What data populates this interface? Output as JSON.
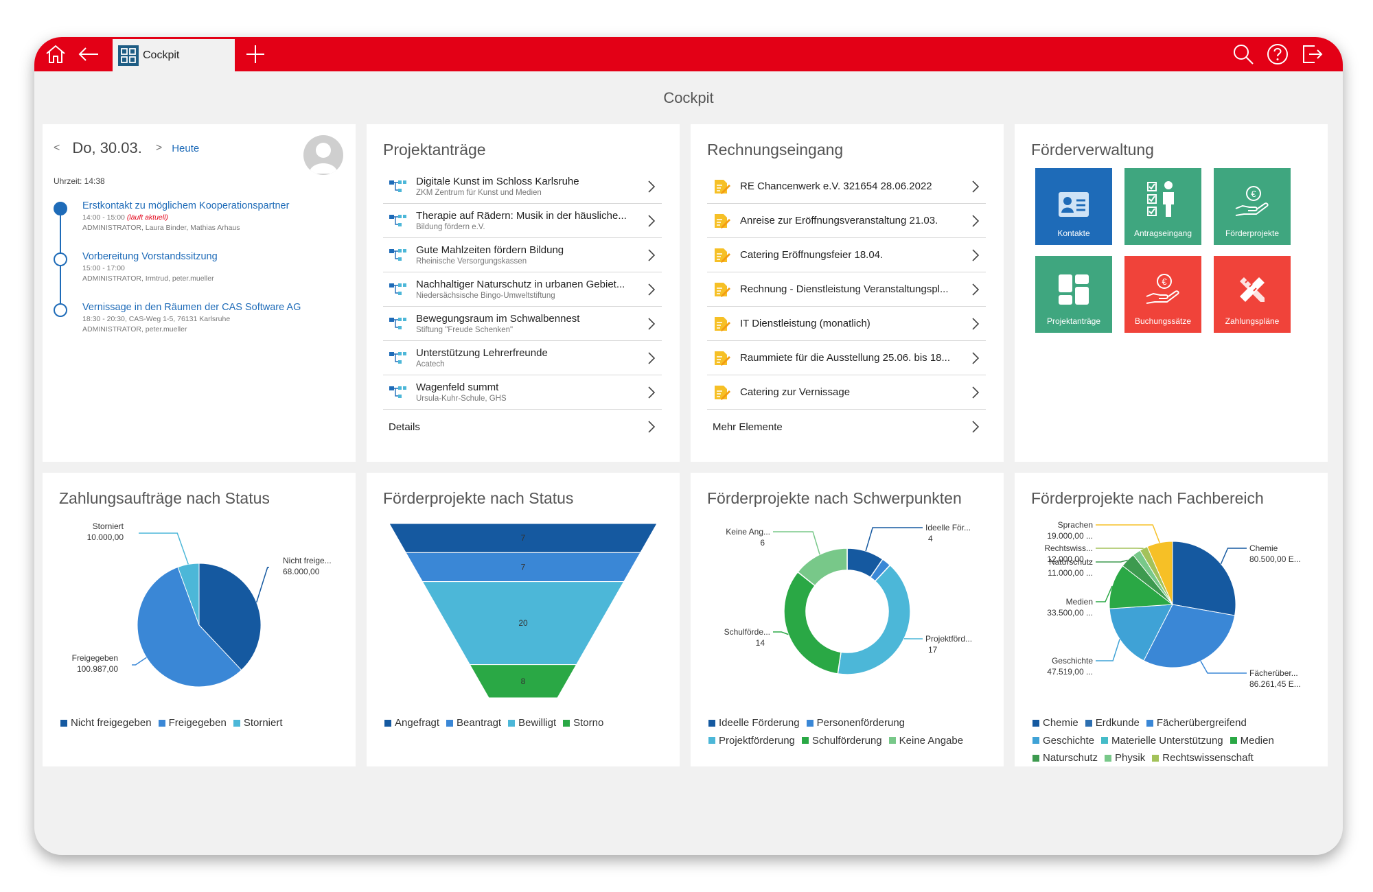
{
  "topbar": {
    "tab_label": "Cockpit",
    "icons": [
      "home-icon",
      "back-arrow-icon",
      "cockpit-logo-icon",
      "plus-icon",
      "search-icon",
      "help-icon",
      "logout-icon"
    ]
  },
  "page": {
    "title": "Cockpit"
  },
  "calendar": {
    "prev": "<",
    "date": "Do, 30.03.",
    "next": ">",
    "today": "Heute",
    "time": "Uhrzeit: 14:38",
    "events": [
      {
        "title": "Erstkontakt zu möglichem Kooperationspartner",
        "time": "14:00 - 15:00",
        "now": "(läuft aktuell)",
        "people": "ADMINISTRATOR,  Laura Binder,  Mathias Arhaus"
      },
      {
        "title": "Vorbereitung Vorstandssitzung",
        "time": "15:00 - 17:00",
        "now": "",
        "people": "ADMINISTRATOR,  Irmtrud,  peter.mueller"
      },
      {
        "title": "Vernissage in den Räumen der CAS Software AG",
        "time": "18:30 - 20:30, CAS-Weg 1-5, 76131 Karlsruhe",
        "now": "",
        "people": "ADMINISTRATOR,  peter.mueller"
      }
    ]
  },
  "projektantraege": {
    "title": "Projektanträge",
    "items": [
      {
        "title": "Digitale Kunst im Schloss Karlsruhe",
        "sub": "ZKM Zentrum für Kunst und Medien"
      },
      {
        "title": "Therapie auf Rädern: Musik in der häusliche...",
        "sub": "Bildung fördern e.V."
      },
      {
        "title": "Gute Mahlzeiten fördern Bildung",
        "sub": "Rheinische Versorgungskassen"
      },
      {
        "title": "Nachhaltiger Naturschutz in urbanen Gebiet...",
        "sub": "Niedersächsische Bingo-Umweltstiftung"
      },
      {
        "title": "Bewegungsraum im Schwalbennest",
        "sub": "Stiftung \"Freude Schenken\""
      },
      {
        "title": "Unterstützung Lehrerfreunde",
        "sub": "Acatech"
      },
      {
        "title": "Wagenfeld summt",
        "sub": "Ursula-Kuhr-Schule, GHS"
      }
    ],
    "footer": "Details"
  },
  "rechnungseingang": {
    "title": "Rechnungseingang",
    "items": [
      "RE Chancenwerk e.V. 321654 28.06.2022",
      "Anreise zur Eröffnungsveranstaltung 21.03.",
      "Catering Eröffnungsfeier 18.04.",
      "Rechnung - Dienstleistung Veranstaltungspl...",
      "IT Dienstleistung (monatlich)",
      "Raummiete für die Ausstellung 25.06. bis 18...",
      "Catering zur Vernissage"
    ],
    "footer": "Mehr Elemente"
  },
  "foerderverwaltung": {
    "title": "Förderverwaltung",
    "tiles": [
      {
        "label": "Kontakte",
        "color": "#1e6bb8",
        "icon": "contact-card-icon"
      },
      {
        "label": "Antragseingang",
        "color": "#3fa67f",
        "icon": "checklist-person-icon"
      },
      {
        "label": "Förderprojekte",
        "color": "#3fa67f",
        "icon": "euro-hand-icon"
      },
      {
        "label": "Projektanträge",
        "color": "#3fa67f",
        "icon": "dashboard-tiles-icon"
      },
      {
        "label": "Buchungssätze",
        "color": "#f0433a",
        "icon": "euro-hand-icon"
      },
      {
        "label": "Zahlungspläne",
        "color": "#f0433a",
        "icon": "pencil-ruler-icon"
      }
    ]
  },
  "chart_titles": {
    "zahlungsauftraege": "Zahlungsaufträge nach Status",
    "foerderprojekte_status": "Förderprojekte nach Status",
    "schwerpunkte": "Förderprojekte nach Schwerpunkten",
    "fachbereich": "Förderprojekte nach Fachbereich"
  },
  "chart_data": [
    {
      "type": "pie",
      "title": "Zahlungsaufträge nach Status",
      "series": [
        {
          "name": "Nicht freigegeben",
          "value": 68000,
          "label": "Nicht freige...",
          "value_label": "68.000,00",
          "color": "#1559a0"
        },
        {
          "name": "Freigegeben",
          "value": 100987,
          "label": "Freigegeben",
          "value_label": "100.987,00",
          "color": "#3a87d6"
        },
        {
          "name": "Storniert",
          "value": 10000,
          "label": "Storniert",
          "value_label": "10.000,00",
          "color": "#4cb7d8"
        }
      ],
      "legend": "bottom"
    },
    {
      "type": "funnel",
      "title": "Förderprojekte nach Status",
      "stages": [
        {
          "name": "Angefragt",
          "value": 7,
          "color": "#1559a0"
        },
        {
          "name": "Beantragt",
          "value": 7,
          "color": "#3a87d6"
        },
        {
          "name": "Bewilligt",
          "value": 20,
          "color": "#4cb7d8"
        },
        {
          "name": "Storno",
          "value": 8,
          "color": "#2aa845"
        }
      ],
      "legend": "bottom"
    },
    {
      "type": "donut",
      "title": "Förderprojekte nach Schwerpunkten",
      "series": [
        {
          "name": "Ideelle Förderung",
          "value": 4,
          "label": "Ideelle För...",
          "color": "#1559a0"
        },
        {
          "name": "Personenförderung",
          "value": 1,
          "label": "",
          "color": "#3a87d6"
        },
        {
          "name": "Projektförderung",
          "value": 17,
          "label": "Projektförd...",
          "color": "#4cb7d8"
        },
        {
          "name": "Schulförderung",
          "value": 14,
          "label": "Schulförde...",
          "color": "#2aa845"
        },
        {
          "name": "Keine Angabe",
          "value": 6,
          "label": "Keine Ang...",
          "color": "#78c889"
        }
      ],
      "legend": "bottom"
    },
    {
      "type": "pie",
      "title": "Förderprojekte nach Fachbereich",
      "series": [
        {
          "name": "Chemie",
          "value": 80500,
          "label": "Chemie",
          "value_label": "80.500,00 E...",
          "color": "#1559a0"
        },
        {
          "name": "Fächerübergreifend",
          "value": 86261.45,
          "label": "Fächerüber...",
          "value_label": "86.261,45 E...",
          "color": "#3a87d6"
        },
        {
          "name": "Geschichte",
          "value": 47519,
          "label": "Geschichte",
          "value_label": "47.519,00 ...",
          "color": "#3fa2d6"
        },
        {
          "name": "Materielle Unterstützung",
          "value": 0,
          "label": "",
          "value_label": "",
          "color": "#45bcc8"
        },
        {
          "name": "Medien",
          "value": 33500,
          "label": "Medien",
          "value_label": "33.500,00 ...",
          "color": "#2aa845"
        },
        {
          "name": "Naturschutz",
          "value": 11000,
          "label": "Naturschutz",
          "value_label": "11.000,00 ...",
          "color": "#3d9a4f"
        },
        {
          "name": "Physik",
          "value": 6000,
          "label": "",
          "value_label": "",
          "color": "#78c889"
        },
        {
          "name": "Rechtswissenschaft",
          "value": 6000,
          "label": "Rechtswiss...",
          "value_label": "12.000,00 ...",
          "color": "#a3c25a"
        },
        {
          "name": "Sprachen",
          "value": 19000,
          "label": "Sprachen",
          "value_label": "19.000,00 ...",
          "color": "#f6c026"
        }
      ],
      "legend_items": [
        "Chemie",
        "Erdkunde",
        "Fächerübergreifend",
        "Geschichte",
        "Materielle Unterstützung",
        "Medien",
        "Naturschutz",
        "Physik",
        "Rechtswissenschaft"
      ],
      "legend_colors": [
        "#1559a0",
        "#2d6fb0",
        "#3a87d6",
        "#3fa2d6",
        "#45bcc8",
        "#2aa845",
        "#3d9a4f",
        "#78c889",
        "#a3c25a"
      ],
      "legend": "bottom"
    }
  ]
}
